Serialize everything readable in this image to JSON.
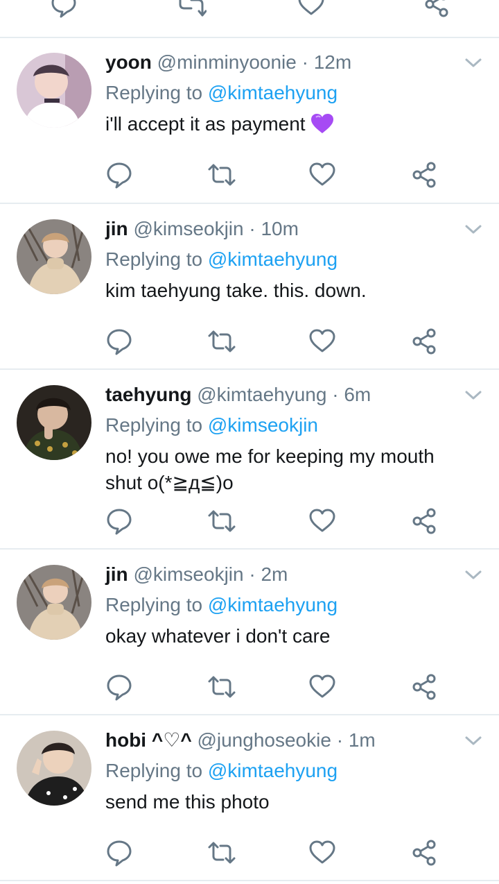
{
  "colors": {
    "accent": "#1da1f2",
    "muted": "#657786",
    "text": "#14171a",
    "divider": "#e6ecf0",
    "heart": "#a64bf4"
  },
  "icons": {
    "reply": "reply-icon",
    "retweet": "retweet-icon",
    "like": "heart-icon",
    "share": "share-icon",
    "more": "chevron-down-icon"
  },
  "replying_label": "Replying to",
  "tweets": [
    {
      "name": "yoon",
      "handle": "@minminyoonie",
      "time": "12m",
      "replying_to": "@kimtaehyung",
      "text": "i'll accept it as payment",
      "emoji": "💜"
    },
    {
      "name": "jin",
      "handle": "@kimseokjin",
      "time": "10m",
      "replying_to": "@kimtaehyung",
      "text": "kim taehyung take. this. down."
    },
    {
      "name": "taehyung",
      "handle": "@kimtaehyung",
      "time": "6m",
      "replying_to": "@kimseokjin",
      "text": "no! you owe me for keeping my mouth shut o(*≧д≦)o"
    },
    {
      "name": "jin",
      "handle": "@kimseokjin",
      "time": "2m",
      "replying_to": "@kimtaehyung",
      "text": "okay whatever i don't care"
    },
    {
      "name": "hobi ^♡^",
      "handle": "@junghoseokie",
      "time": "1m",
      "replying_to": "@kimtaehyung",
      "text": "send me this photo"
    }
  ]
}
